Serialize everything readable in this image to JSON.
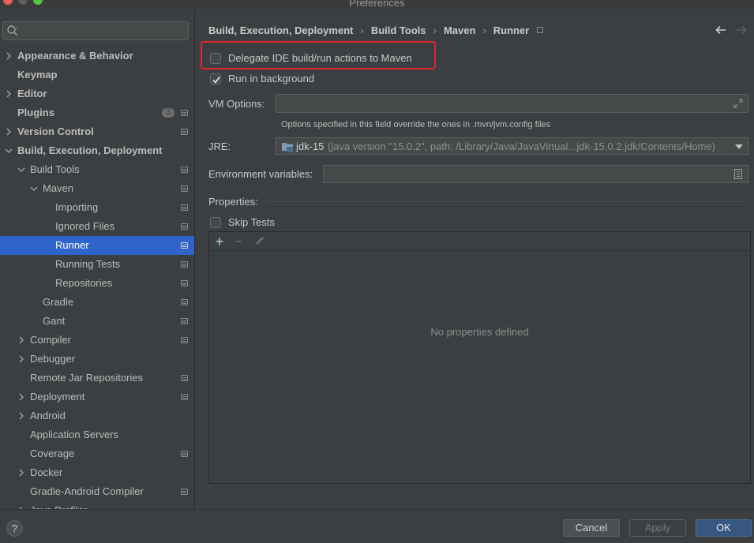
{
  "window": {
    "title": "Preferences"
  },
  "sidebar": {
    "search_placeholder": "",
    "items": [
      {
        "label": "Appearance & Behavior",
        "level": 0,
        "arrow": "right",
        "bold": true,
        "modified": false
      },
      {
        "label": "Keymap",
        "level": 0,
        "arrow": "none",
        "bold": true,
        "modified": false
      },
      {
        "label": "Editor",
        "level": 0,
        "arrow": "right",
        "bold": true,
        "modified": false
      },
      {
        "label": "Plugins",
        "level": 0,
        "arrow": "none",
        "bold": true,
        "modified": true,
        "badge": "3"
      },
      {
        "label": "Version Control",
        "level": 0,
        "arrow": "right",
        "bold": true,
        "modified": true
      },
      {
        "label": "Build, Execution, Deployment",
        "level": 0,
        "arrow": "down",
        "bold": true,
        "modified": false
      },
      {
        "label": "Build Tools",
        "level": 1,
        "arrow": "down",
        "bold": false,
        "modified": true
      },
      {
        "label": "Maven",
        "level": 2,
        "arrow": "down",
        "bold": false,
        "modified": true
      },
      {
        "label": "Importing",
        "level": 3,
        "arrow": "none",
        "bold": false,
        "modified": true
      },
      {
        "label": "Ignored Files",
        "level": 3,
        "arrow": "none",
        "bold": false,
        "modified": true
      },
      {
        "label": "Runner",
        "level": 3,
        "arrow": "none",
        "bold": false,
        "modified": true,
        "selected": true
      },
      {
        "label": "Running Tests",
        "level": 3,
        "arrow": "none",
        "bold": false,
        "modified": true
      },
      {
        "label": "Repositories",
        "level": 3,
        "arrow": "none",
        "bold": false,
        "modified": true
      },
      {
        "label": "Gradle",
        "level": 2,
        "arrow": "none",
        "bold": false,
        "modified": true
      },
      {
        "label": "Gant",
        "level": 2,
        "arrow": "none",
        "bold": false,
        "modified": true
      },
      {
        "label": "Compiler",
        "level": 1,
        "arrow": "right",
        "bold": false,
        "modified": true
      },
      {
        "label": "Debugger",
        "level": 1,
        "arrow": "right",
        "bold": false,
        "modified": false
      },
      {
        "label": "Remote Jar Repositories",
        "level": 1,
        "arrow": "none",
        "bold": false,
        "modified": true
      },
      {
        "label": "Deployment",
        "level": 1,
        "arrow": "right",
        "bold": false,
        "modified": true
      },
      {
        "label": "Android",
        "level": 1,
        "arrow": "right",
        "bold": false,
        "modified": false
      },
      {
        "label": "Application Servers",
        "level": 1,
        "arrow": "none",
        "bold": false,
        "modified": false
      },
      {
        "label": "Coverage",
        "level": 1,
        "arrow": "none",
        "bold": false,
        "modified": true
      },
      {
        "label": "Docker",
        "level": 1,
        "arrow": "right",
        "bold": false,
        "modified": false
      },
      {
        "label": "Gradle-Android Compiler",
        "level": 1,
        "arrow": "none",
        "bold": false,
        "modified": true
      },
      {
        "label": "Java Profiler",
        "level": 1,
        "arrow": "right",
        "bold": false,
        "modified": false
      }
    ]
  },
  "breadcrumb": [
    "Build, Execution, Deployment",
    "Build Tools",
    "Maven",
    "Runner"
  ],
  "runner": {
    "delegate_label": "Delegate IDE build/run actions to Maven",
    "delegate_checked": false,
    "background_label": "Run in background",
    "background_checked": true,
    "vm_options_label": "VM Options:",
    "vm_options_value": "",
    "vm_options_hint": "Options specified in this field override the ones in .mvn/jvm.config files",
    "jre_label": "JRE:",
    "jre_name": "jdk-15",
    "jre_detail": "(java version \"15.0.2\", path: /Library/Java/JavaVirtual...jdk-15.0.2.jdk/Contents/Home)",
    "env_label": "Environment variables:",
    "env_value": "",
    "properties_label": "Properties:",
    "skip_tests_label": "Skip Tests",
    "skip_tests_checked": false,
    "add_symbol": "+",
    "remove_symbol": "−",
    "empty_message": "No properties defined"
  },
  "footer": {
    "help_symbol": "?",
    "cancel_label": "Cancel",
    "apply_label": "Apply",
    "ok_label": "OK"
  },
  "colors": {
    "background": "#3c3f41",
    "selection": "#2f65ca",
    "highlight_box": "#e3262d",
    "ok_button": "#365880"
  }
}
